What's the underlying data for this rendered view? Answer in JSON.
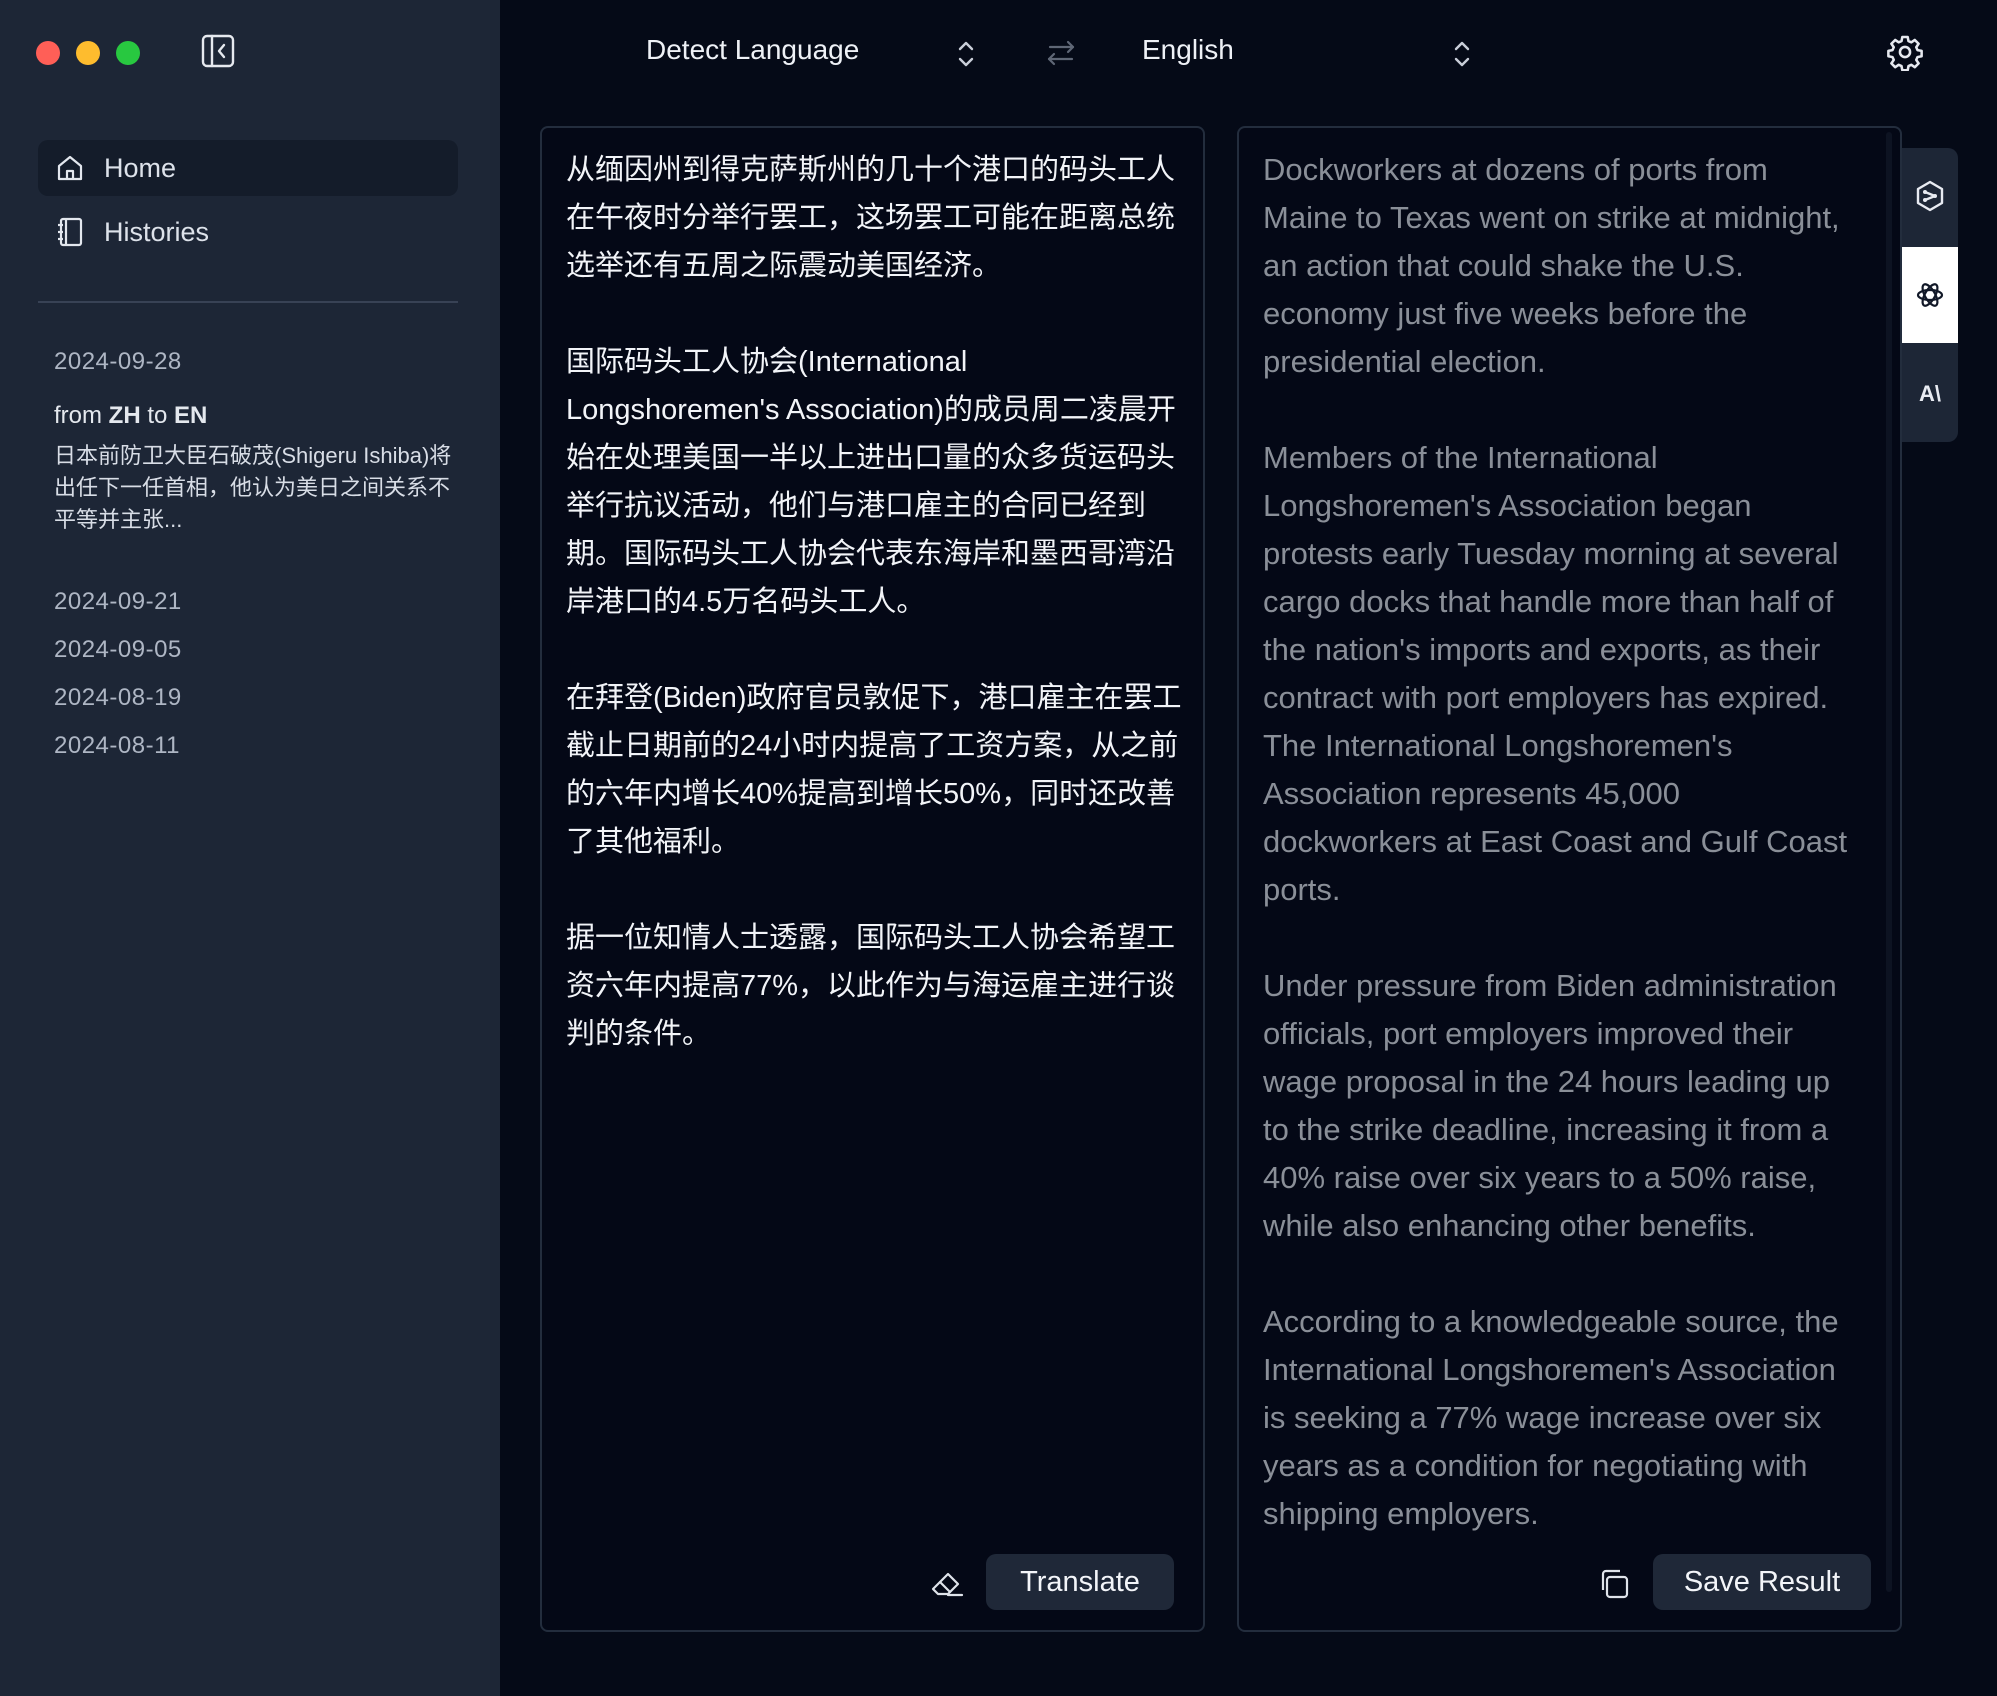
{
  "colors": {
    "window_bg": "#050a17",
    "sidebar_bg": "#1d2636",
    "accent_button": "#1f2838",
    "traffic_red": "#ff5f57",
    "traffic_yellow": "#febc2e",
    "traffic_green": "#28c840"
  },
  "sidebar": {
    "nav": [
      {
        "label": "Home",
        "icon": "home-icon",
        "active": true
      },
      {
        "label": "Histories",
        "icon": "notebook-icon",
        "active": false
      }
    ],
    "history": {
      "first_date": "2024-09-28",
      "entry": {
        "from_word": "from",
        "source_lang": "ZH",
        "to_word": "to",
        "target_lang": "EN",
        "preview": "日本前防卫大臣石破茂(Shigeru Ishiba)将出任下一任首相，他认为美日之间关系不平等并主张..."
      },
      "dates": [
        "2024-09-21",
        "2024-09-05",
        "2024-08-19",
        "2024-08-11"
      ]
    }
  },
  "toolbar": {
    "source_language": "Detect Language",
    "target_language": "English"
  },
  "source_panel": {
    "text": "从缅因州到得克萨斯州的几十个港口的码头工人在午夜时分举行罢工，这场罢工可能在距离总统选举还有五周之际震动美国经济。\n\n国际码头工人协会(International Longshoremen's Association)的成员周二凌晨开始在处理美国一半以上进出口量的众多货运码头举行抗议活动，他们与港口雇主的合同已经到期。国际码头工人协会代表东海岸和墨西哥湾沿岸港口的4.5万名码头工人。\n\n在拜登(Biden)政府官员敦促下，港口雇主在罢工截止日期前的24小时内提高了工资方案，从之前的六年内增长40%提高到增长50%，同时还改善了其他福利。\n\n据一位知情人士透露，国际码头工人协会希望工资六年内提高77%，以此作为与海运雇主进行谈判的条件。",
    "translate_label": "Translate"
  },
  "result_panel": {
    "text": "Dockworkers at dozens of ports from Maine to Texas went on strike at midnight, an action that could shake the U.S. economy just five weeks before the presidential election.\n\nMembers of the International Longshoremen's Association began protests early Tuesday morning at several cargo docks that handle more than half of the nation's imports and exports, as their contract with port employers has expired. The International Longshoremen's Association represents 45,000 dockworkers at East Coast and Gulf Coast ports.\n\nUnder pressure from Biden administration officials, port employers improved their wage proposal in the 24 hours leading up to the strike deadline, increasing it from a 40% raise over six years to a 50% raise, while also enhancing other benefits.\n\nAccording to a knowledgeable source, the International Longshoremen's Association is seeking a 77% wage increase over six years as a condition for negotiating with shipping employers.",
    "save_label": "Save Result"
  },
  "engines": [
    {
      "icon": "deepl-icon"
    },
    {
      "icon": "openai-icon",
      "active": true
    },
    {
      "icon": "anthropic-icon",
      "label": "A\\"
    }
  ]
}
